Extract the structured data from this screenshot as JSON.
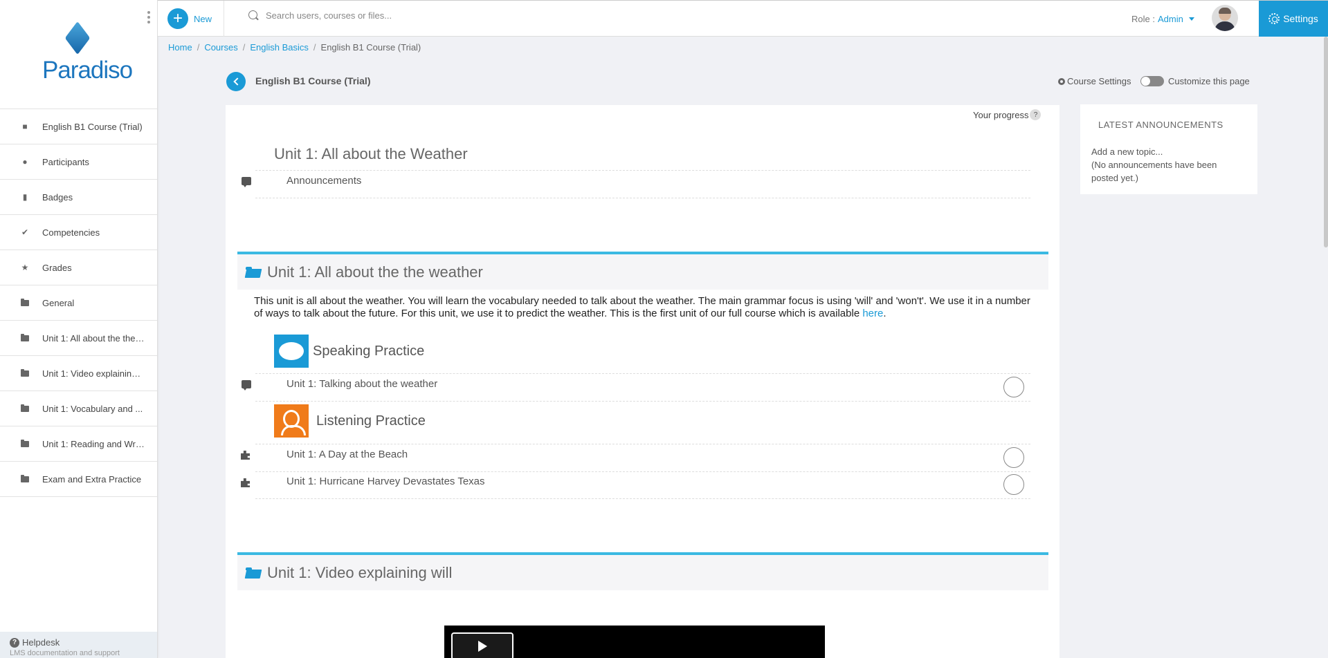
{
  "sidebar": {
    "logo_text": "Paradiso",
    "items": [
      {
        "label": "English B1 Course (Trial)",
        "icon": "book-icon"
      },
      {
        "label": "Participants",
        "icon": "users-icon"
      },
      {
        "label": "Badges",
        "icon": "bookmark-icon"
      },
      {
        "label": "Competencies",
        "icon": "check-circle-icon"
      },
      {
        "label": "Grades",
        "icon": "star-icon"
      },
      {
        "label": "General",
        "icon": "folder-icon"
      },
      {
        "label": "Unit 1: All about the the ...",
        "icon": "folder-icon"
      },
      {
        "label": "Unit 1: Video explaining ...",
        "icon": "folder-icon"
      },
      {
        "label": "Unit 1: Vocabulary and ...",
        "icon": "folder-icon"
      },
      {
        "label": "Unit 1: Reading and Writ...",
        "icon": "folder-icon"
      },
      {
        "label": "Exam and Extra Practice",
        "icon": "folder-icon"
      }
    ],
    "helpdesk": "Helpdesk",
    "helpdesk_sub": "LMS documentation and support"
  },
  "topbar": {
    "new_label": "New",
    "search_placeholder": "Search users, courses or files...",
    "role_label": "Role :",
    "role_value": "Admin",
    "settings_label": "Settings"
  },
  "breadcrumb": {
    "home": "Home",
    "courses": "Courses",
    "category": "English Basics",
    "current": "English B1 Course (Trial)"
  },
  "header": {
    "course_title": "English B1 Course (Trial)",
    "course_settings": "Course Settings",
    "customize": "Customize this page"
  },
  "progress_label": "Your progress",
  "section0": {
    "title": "Unit 1: All about the Weather",
    "activities": [
      {
        "label": "Announcements",
        "icon": "chat-icon"
      }
    ]
  },
  "section1": {
    "title": "Unit 1: All about the the weather",
    "summary": "This unit is all about the weather. You will learn the vocabulary needed to talk about the weather. The main grammar focus is using 'will' and 'won't'. We use it in a number of ways to talk about the future. For this unit, we use it to predict the weather. This is the first unit of our full course which is available ",
    "summary_link": "here",
    "summary_end": ".",
    "speaking_label": "Speaking Practice",
    "speaking_activity": "Unit 1: Talking about the weather",
    "listening_label": "Listening Practice",
    "listening_activities": [
      "Unit 1: A Day at the Beach",
      "Unit 1: Hurricane Harvey Devastates Texas"
    ]
  },
  "section2": {
    "title": "Unit 1: Video explaining will"
  },
  "announcements": {
    "heading": "LATEST ANNOUNCEMENTS",
    "add_topic": "Add a new topic...",
    "empty": "(No announcements have been posted yet.)"
  },
  "colors": {
    "accent": "#1a9ad6",
    "section_border": "#3bb9e2",
    "listening_orange": "#f07b1a"
  }
}
